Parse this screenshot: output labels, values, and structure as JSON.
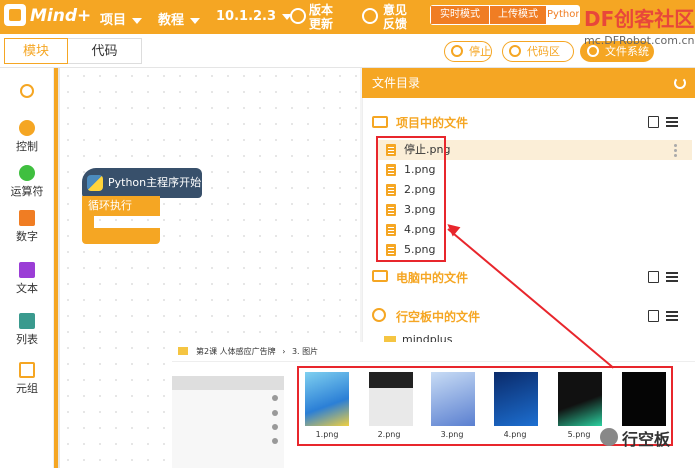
{
  "topbar": {
    "logo_text": "Mind+",
    "menus": [
      {
        "label": "项目"
      },
      {
        "label": "教程"
      },
      {
        "label": "10.1.2.3"
      }
    ],
    "update_label": [
      "版本",
      "更新"
    ],
    "feedback_label": [
      "意见",
      "反馈"
    ],
    "modes": [
      "实时模式",
      "上传模式",
      "Python模式"
    ],
    "watermark_title": "DF创客社区",
    "watermark_url": "mc.DFRobot.com.cn"
  },
  "tabs": {
    "blocks": "模块",
    "code": "代码"
  },
  "actions": {
    "stop": "停止",
    "code_area": "代码区",
    "file_system": "文件系统"
  },
  "palette": [
    {
      "label": "控制",
      "color": "#f5a623",
      "shape": "circle"
    },
    {
      "label": "运算符",
      "color": "#3fbf3f",
      "shape": "circle"
    },
    {
      "label": "数字",
      "color": "#f07d23",
      "shape": "square"
    },
    {
      "label": "文本",
      "color": "#9b3dd6",
      "shape": "square"
    },
    {
      "label": "列表",
      "color": "#3a9a8e",
      "shape": "square"
    },
    {
      "label": "元组",
      "color": "#f5a623",
      "shape": "square"
    }
  ],
  "blocks": {
    "start": "Python主程序开始",
    "loop": "循环执行"
  },
  "files": {
    "header": "文件目录",
    "project_section": "项目中的文件",
    "project_files": [
      "停止.png",
      "1.png",
      "2.png",
      "3.png",
      "4.png",
      "5.png"
    ],
    "computer_section": "电脑中的文件",
    "board_section": "行空板中的文件",
    "board_folder": "mindplus"
  },
  "explorer": {
    "path": [
      "第2课 人体感应广告牌",
      "3. 图片"
    ],
    "thumbnails": [
      "1.png",
      "2.png",
      "3.png",
      "4.png",
      "5.png"
    ]
  },
  "watermark_bottom": "行空板",
  "colors": {
    "accent": "#f5a623",
    "highlight": "#e8262c",
    "python_dark": "#38506b"
  }
}
